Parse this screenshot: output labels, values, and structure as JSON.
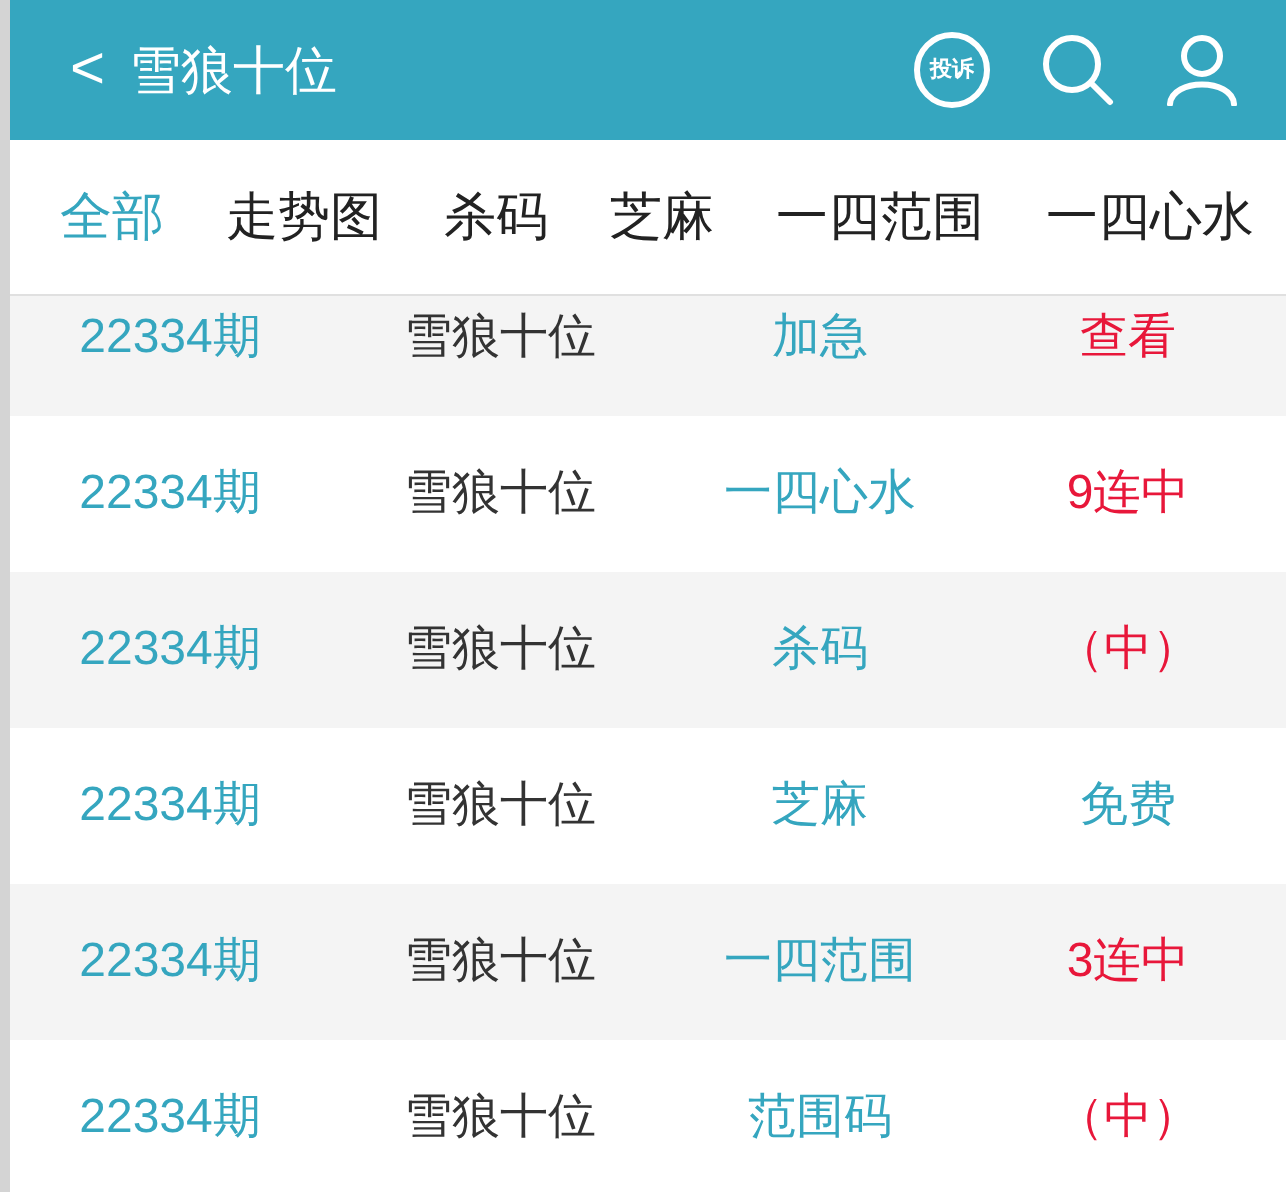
{
  "header": {
    "back": "<",
    "title": "雪狼十位",
    "complaint": "投诉"
  },
  "tabs": [
    {
      "label": "全部",
      "selected": true
    },
    {
      "label": "走势图",
      "selected": false
    },
    {
      "label": "杀码",
      "selected": false
    },
    {
      "label": "芝麻",
      "selected": false
    },
    {
      "label": "一四范围",
      "selected": false
    },
    {
      "label": "一四心水",
      "selected": false
    }
  ],
  "rows": [
    {
      "period": "22334期",
      "name": "雪狼十位",
      "type": "加急",
      "result": "查看",
      "color": "#e8173a"
    },
    {
      "period": "22334期",
      "name": "雪狼十位",
      "type": "一四心水",
      "result": "9连中",
      "color": "#e8173a"
    },
    {
      "period": "22334期",
      "name": "雪狼十位",
      "type": "杀码",
      "result": "（中）",
      "color": "#e8173a"
    },
    {
      "period": "22334期",
      "name": "雪狼十位",
      "type": "芝麻",
      "result": "免费",
      "color": "#35a6bf"
    },
    {
      "period": "22334期",
      "name": "雪狼十位",
      "type": "一四范围",
      "result": "3连中",
      "color": "#e8173a"
    },
    {
      "period": "22334期",
      "name": "雪狼十位",
      "type": "范围码",
      "result": "（中）",
      "color": "#e8173a"
    }
  ]
}
